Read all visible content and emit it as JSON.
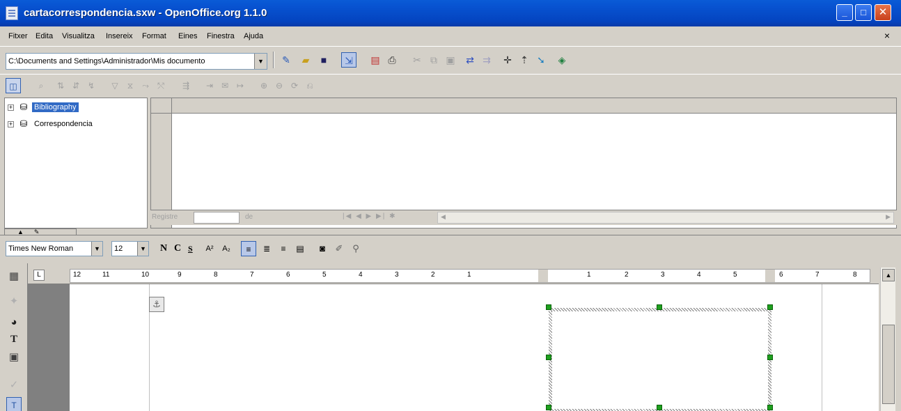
{
  "window": {
    "title": "cartacorrespondencia.sxw - OpenOffice.org 1.1.0",
    "minimize": "_",
    "maximize": "□",
    "close": "✕"
  },
  "menubar": {
    "items": [
      "Fitxer",
      "Edita",
      "Visualitza",
      "Insereix",
      "Format",
      "Eines",
      "Finestra",
      "Ajuda"
    ],
    "close_doc": "×"
  },
  "function_bar": {
    "url": "C:\\Documents and Settings\\Administrador\\Mis documento",
    "dropdown": "▼"
  },
  "data_sources": {
    "items": [
      {
        "expand": "+",
        "label": "Bibliography",
        "selected": true
      },
      {
        "expand": "+",
        "label": "Correspondencia",
        "selected": false
      }
    ]
  },
  "record_nav": {
    "record_label": "Registre",
    "of_label": "de",
    "nav_buttons": "|◀ ◀ ▶ ▶| ✱",
    "scroll_left": "◀",
    "scroll_right": "▶"
  },
  "object_bar": {
    "font_name": "Times New Roman",
    "font_size": "12",
    "bold": "N",
    "italic": "C",
    "underline": "S"
  },
  "ruler": {
    "tab_marker": "L",
    "ticks": [
      "12",
      "11",
      "10",
      "9",
      "8",
      "7",
      "6",
      "5",
      "4",
      "3",
      "2",
      "1",
      "1",
      "2",
      "3",
      "4",
      "5",
      "6",
      "7",
      "8"
    ]
  },
  "icons": {
    "app": "document-icon",
    "anchor": "anchor-icon",
    "text_tool": "T"
  }
}
